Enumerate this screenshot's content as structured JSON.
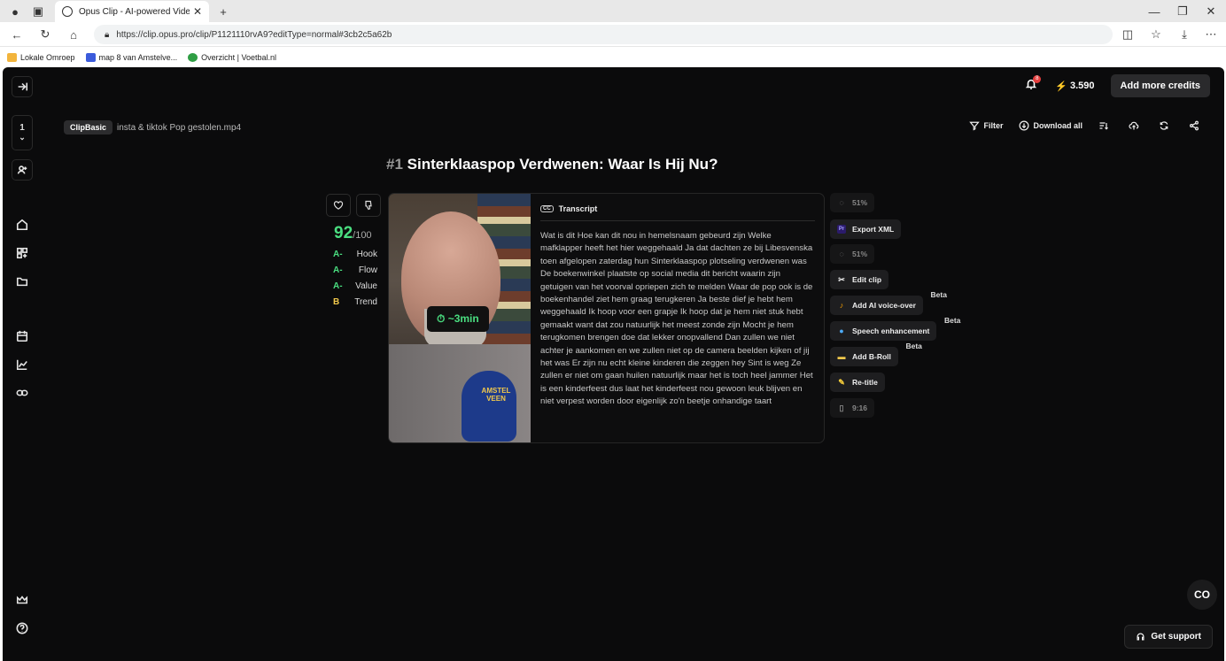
{
  "browser": {
    "tab_title": "Opus Clip - AI-powered Video Re",
    "url": "https://clip.opus.pro/clip/P1121110rvA9?editType=normal#3cb2c5a62b",
    "bookmarks": [
      {
        "label": "Lokale Omroep",
        "color": "#f2b43c"
      },
      {
        "label": "map 8 van Amstelve...",
        "color": "#3b5bdb"
      },
      {
        "label": "Overzicht | Voetbal.nl",
        "color": "#2f9e44"
      }
    ]
  },
  "header": {
    "notification_count": "8",
    "credits": "3.590",
    "add_credits_label": "Add more credits"
  },
  "sidebar": {
    "page_number": "1"
  },
  "project": {
    "badge": "ClipBasic",
    "filename": "insta & tiktok Pop gestolen.mp4"
  },
  "toolbar": {
    "filter_label": "Filter",
    "download_all_label": "Download all"
  },
  "clip": {
    "index": "#1",
    "title": "Sinterklaaspop Verdwenen: Waar Is Hij Nu?",
    "score": "92",
    "score_max": "/100",
    "grades": [
      {
        "grade": "A-",
        "label": "Hook"
      },
      {
        "grade": "A-",
        "label": "Flow"
      },
      {
        "grade": "A-",
        "label": "Value"
      },
      {
        "grade": "B",
        "label": "Trend"
      }
    ],
    "duration": "~3min",
    "mic_text": "AMSTEL VEEN",
    "transcript_label": "Transcript",
    "transcript": "Wat is dit Hoe kan dit nou in hemelsnaam gebeurd zijn Welke mafklapper heeft het hier weggehaald Ja dat dachten ze bij Libesvenska toen afgelopen zaterdag hun Sinterklaaspop plotseling verdwenen was De boekenwinkel plaatste op social media dit bericht waarin zijn getuigen van het voorval opriepen zich te melden Waar de pop ook is de boekenhandel ziet hem graag terugkeren Ja beste dief je hebt hem weggehaald Ik hoop voor een grapje Ik hoop dat je hem niet stuk hebt gemaakt want dat zou natuurlijk het meest zonde zijn Mocht je hem terugkomen brengen doe dat lekker onopvallend Dan zullen we niet achter je aankomen en we zullen niet op de camera beelden kijken of jij het was Er zijn nu echt kleine kinderen die zeggen hey Sint is weg Ze zullen er niet om gaan huilen natuurlijk maar het is toch heel jammer Het is een kinderfeest dus laat het kinderfeest nou gewoon leuk blijven en niet verpest worden door eigenlijk zo'n beetje onhandige taart"
  },
  "actions": {
    "progress_1": "51%",
    "export_xml": "Export XML",
    "progress_2": "51%",
    "edit_clip": "Edit clip",
    "ai_voice_over": "Add AI voice-over",
    "speech_enhancement": "Speech enhancement",
    "add_broll": "Add B-Roll",
    "retitle": "Re-title",
    "aspect": "9:16",
    "beta": "Beta"
  },
  "footer": {
    "support_label": "Get support"
  }
}
